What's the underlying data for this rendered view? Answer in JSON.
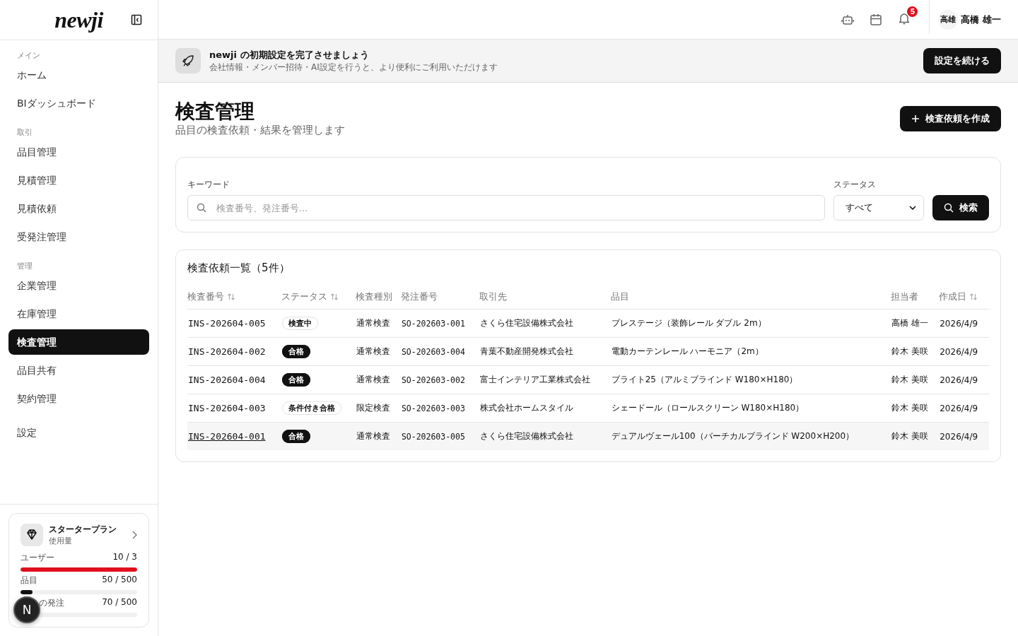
{
  "sidebar": {
    "logo": "newji",
    "groups": [
      {
        "heading": "メイン",
        "items": [
          {
            "label": "ホーム",
            "selected": false
          },
          {
            "label": "BIダッシュボード",
            "selected": false
          }
        ]
      },
      {
        "heading": "取引",
        "items": [
          {
            "label": "品目管理",
            "selected": false
          },
          {
            "label": "見積管理",
            "selected": false
          },
          {
            "label": "見積依頼",
            "selected": false
          },
          {
            "label": "受発注管理",
            "selected": false
          }
        ]
      },
      {
        "heading": "管理",
        "items": [
          {
            "label": "企業管理",
            "selected": false
          },
          {
            "label": "在庫管理",
            "selected": false
          },
          {
            "label": "検査管理",
            "selected": true
          },
          {
            "label": "品目共有",
            "selected": false
          },
          {
            "label": "契約管理",
            "selected": false
          }
        ]
      },
      {
        "items": [
          {
            "label": "設定",
            "selected": false
          }
        ]
      }
    ],
    "plan": {
      "title": "スタータープラン",
      "subtitle": "使用量",
      "usage": [
        {
          "label": "ユーザー",
          "reading": "10 / 3",
          "level": 1,
          "over_limit": true
        },
        {
          "label": "品目",
          "reading": "50 / 500",
          "level": 0.1,
          "over_limit": false
        },
        {
          "label": "の発注",
          "reading": "70 / 500"
        }
      ]
    },
    "fab": "N"
  },
  "header": {
    "notification_count": "5",
    "avatar": "高雄",
    "user_name": "高橋 雄一"
  },
  "banner": {
    "title": "newji の初期設定を完了させましょう",
    "text": "会社情報・メンバー招待・AI設定を行うと、より便利にご利用いただけます",
    "button": "設定を続ける"
  },
  "page": {
    "title": "検査管理",
    "subtitle": "品目の検査依頼・結果を管理します",
    "create_button": "検査依頼を作成"
  },
  "filters": {
    "keyword_label": "キーワード",
    "keyword_placeholder": "検査番号、発注番号...",
    "status_label": "ステータス",
    "status_value": "すべて",
    "search_button": "検索"
  },
  "table": {
    "title": "検査依頼一覧（5件）",
    "columns": [
      {
        "label": "検査番号",
        "sortable": true
      },
      {
        "label": "ステータス",
        "sortable": true
      },
      {
        "label": "検査種別",
        "sortable": false
      },
      {
        "label": "発注番号",
        "sortable": false
      },
      {
        "label": "取引先",
        "sortable": false
      },
      {
        "label": "品目",
        "sortable": false
      },
      {
        "label": "担当者",
        "sortable": false
      },
      {
        "label": "作成日",
        "sortable": true
      }
    ],
    "rows": [
      {
        "id": "INS-202604-005",
        "status": "検査中",
        "status_filled": false,
        "type": "通常検査",
        "order": "SO-202603-001",
        "partner": "さくら住宅設備株式会社",
        "item": "プレステージ（装飾レール ダブル 2m）",
        "owner": "高橋 雄一",
        "date": "2026/4/9",
        "hovered": false
      },
      {
        "id": "INS-202604-002",
        "status": "合格",
        "status_filled": true,
        "type": "通常検査",
        "order": "SO-202603-004",
        "partner": "青葉不動産開発株式会社",
        "item": "電動カーテンレール ハーモニア（2m）",
        "owner": "鈴木 美咲",
        "date": "2026/4/9",
        "hovered": false
      },
      {
        "id": "INS-202604-004",
        "status": "合格",
        "status_filled": true,
        "type": "通常検査",
        "order": "SO-202603-002",
        "partner": "富士インテリア工業株式会社",
        "item": "ブライト25（アルミブラインド W180×H180）",
        "owner": "鈴木 美咲",
        "date": "2026/4/9",
        "hovered": false
      },
      {
        "id": "INS-202604-003",
        "status": "条件付き合格",
        "status_filled": false,
        "type": "限定検査",
        "order": "SO-202603-003",
        "partner": "株式会社ホームスタイル",
        "item": "シェードール（ロールスクリーン W180×H180）",
        "owner": "鈴木 美咲",
        "date": "2026/4/9",
        "hovered": false
      },
      {
        "id": "INS-202604-001",
        "status": "合格",
        "status_filled": true,
        "type": "通常検査",
        "order": "SO-202603-005",
        "partner": "さくら住宅設備株式会社",
        "item": "デュアルヴェール100（バーチカルブラインド W200×H200）",
        "owner": "鈴木 美咲",
        "date": "2026/4/9",
        "hovered": true
      }
    ]
  }
}
